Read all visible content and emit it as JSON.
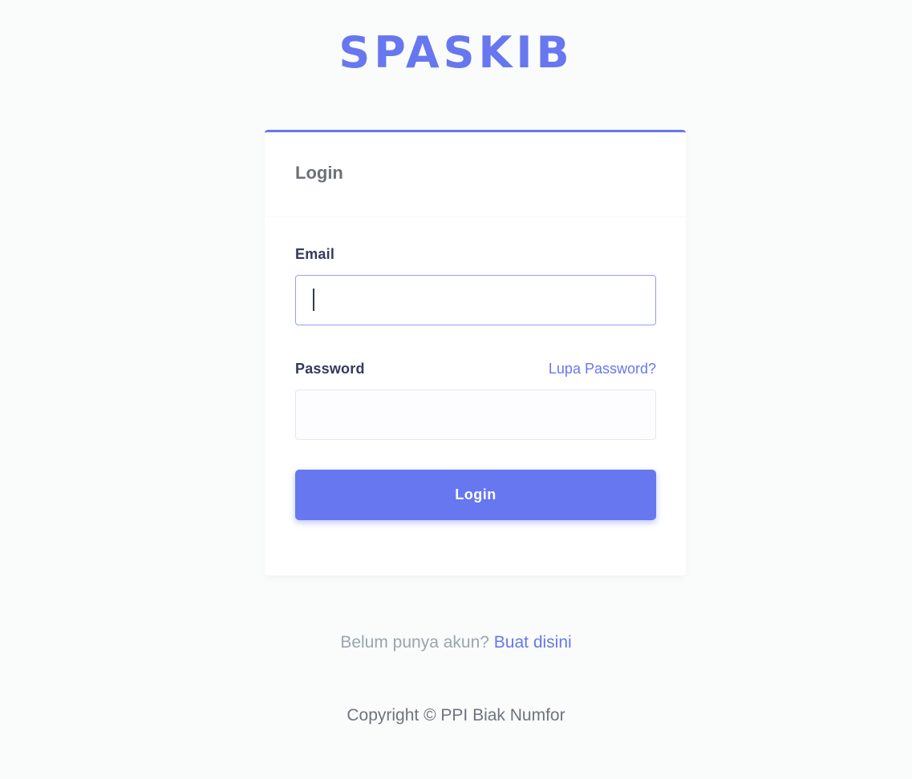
{
  "brand": {
    "name": "SPASKIB",
    "color": "#6777ef"
  },
  "login_card": {
    "title": "Login",
    "email": {
      "label": "Email",
      "value": "",
      "placeholder": ""
    },
    "password": {
      "label": "Password",
      "value": "",
      "placeholder": "",
      "forgot_label": "Lupa Password?"
    },
    "submit_label": "Login"
  },
  "signup": {
    "prompt": "Belum punya akun?",
    "link_label": "Buat disini"
  },
  "footer": {
    "copyright": "Copyright © PPI Biak Numfor"
  },
  "colors": {
    "accent": "#6777ef",
    "background": "#fafbfb",
    "muted_text": "#98a6ad"
  }
}
